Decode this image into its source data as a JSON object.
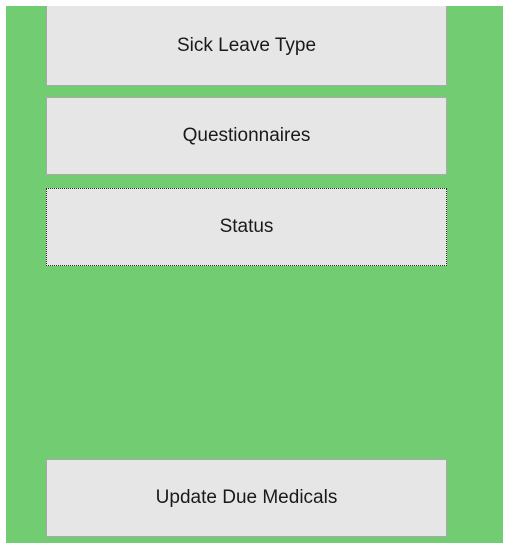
{
  "panel": {
    "background_color": "#72cd72"
  },
  "buttons": {
    "sick_leave_type": "Sick Leave Type",
    "questionnaires": "Questionnaires",
    "status": "Status",
    "update_due_medicals": "Update Due Medicals"
  },
  "focused_button": "Status"
}
